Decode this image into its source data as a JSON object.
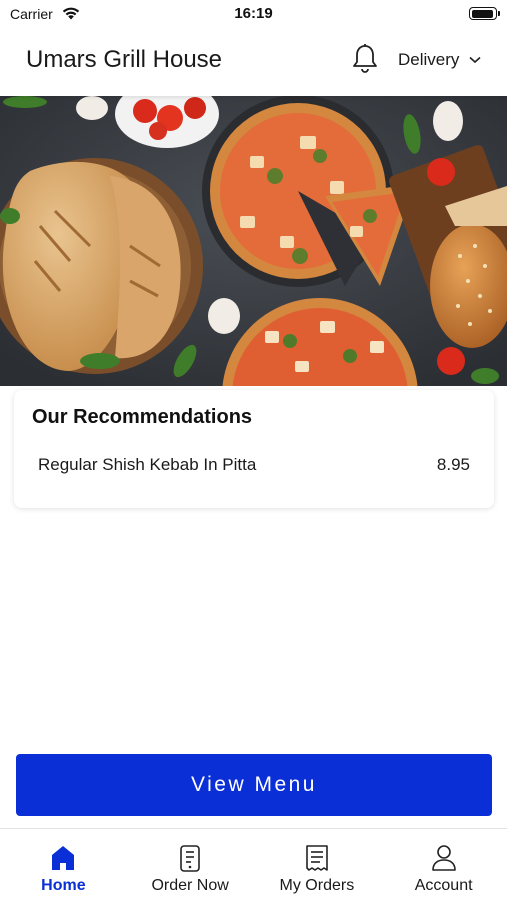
{
  "status_bar": {
    "carrier": "Carrier",
    "time": "16:19"
  },
  "header": {
    "restaurant_name": "Umars Grill House",
    "order_mode": "Delivery"
  },
  "recommendations": {
    "title": "Our Recommendations",
    "items": [
      {
        "name": "Regular Shish Kebab In Pitta",
        "price": "8.95"
      }
    ]
  },
  "view_menu_label": "View Menu",
  "tabs": [
    {
      "label": "Home",
      "icon": "home-icon",
      "active": true
    },
    {
      "label": "Order Now",
      "icon": "order-icon",
      "active": false
    },
    {
      "label": "My Orders",
      "icon": "receipt-icon",
      "active": false
    },
    {
      "label": "Account",
      "icon": "person-icon",
      "active": false
    }
  ],
  "colors": {
    "accent": "#0a2fd6",
    "background": "#ffffff",
    "text": "#1a1a1a"
  }
}
